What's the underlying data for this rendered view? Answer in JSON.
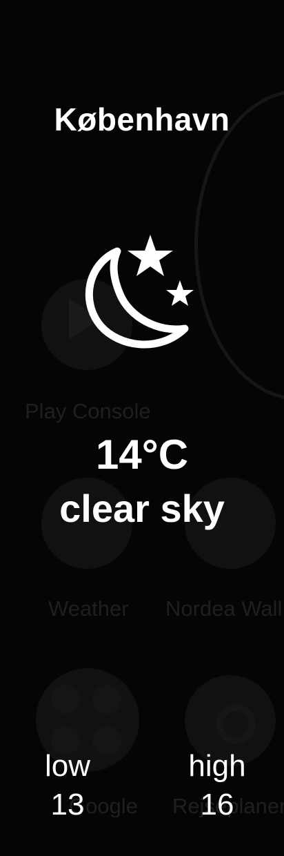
{
  "weather": {
    "city": "København",
    "icon": "moon-stars-icon",
    "temperature": "14°C",
    "description": "clear sky",
    "low_label": "low",
    "low_value": "13",
    "high_label": "high",
    "high_value": "16"
  },
  "background_launcher": {
    "apps": [
      {
        "label": "Play Console"
      },
      {
        "label": "Weather"
      },
      {
        "label": "Nordea Wall"
      },
      {
        "label": "Google"
      },
      {
        "label": "Rejseplanen"
      }
    ]
  },
  "colors": {
    "background": "#050505",
    "foreground_text": "#ffffff",
    "background_label": "#1f1f1f"
  }
}
